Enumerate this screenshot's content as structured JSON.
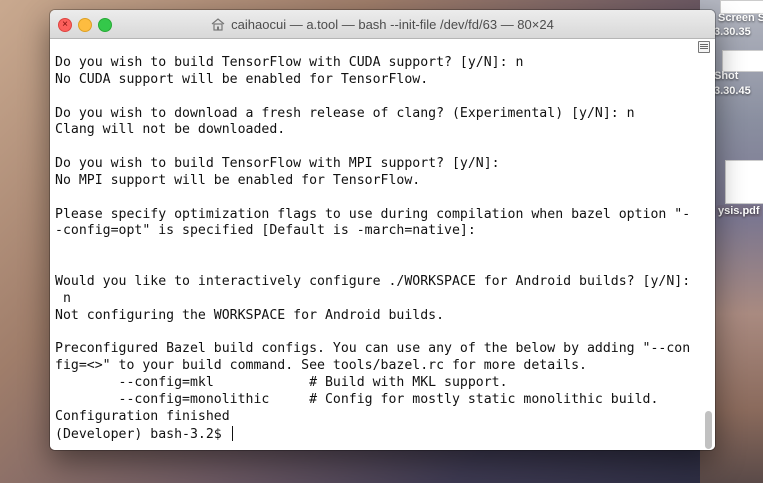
{
  "window": {
    "title": "caihaocui — a.tool — bash --init-file /dev/fd/63 — 80×24",
    "icon": "home-folder-icon",
    "close_glyph": "×"
  },
  "desktop": {
    "labels": [
      "Screen Shot",
      "3.30.35",
      "Shot",
      "3.30.45",
      "ysis.pdf"
    ]
  },
  "terminal": {
    "lines": [
      "Do you wish to build TensorFlow with CUDA support? [y/N]: n",
      "No CUDA support will be enabled for TensorFlow.",
      "",
      "Do you wish to download a fresh release of clang? (Experimental) [y/N]: n",
      "Clang will not be downloaded.",
      "",
      "Do you wish to build TensorFlow with MPI support? [y/N]:",
      "No MPI support will be enabled for TensorFlow.",
      "",
      "Please specify optimization flags to use during compilation when bazel option \"-",
      "-config=opt\" is specified [Default is -march=native]:",
      "",
      "",
      "Would you like to interactively configure ./WORKSPACE for Android builds? [y/N]:",
      " n",
      "Not configuring the WORKSPACE for Android builds.",
      "",
      "Preconfigured Bazel build configs. You can use any of the below by adding \"--con",
      "fig=<>\" to your build command. See tools/bazel.rc for more details.",
      "        --config=mkl            # Build with MKL support.",
      "        --config=monolithic     # Config for mostly static monolithic build.",
      "Configuration finished"
    ],
    "prompt": "(Developer) bash-3.2$ "
  }
}
